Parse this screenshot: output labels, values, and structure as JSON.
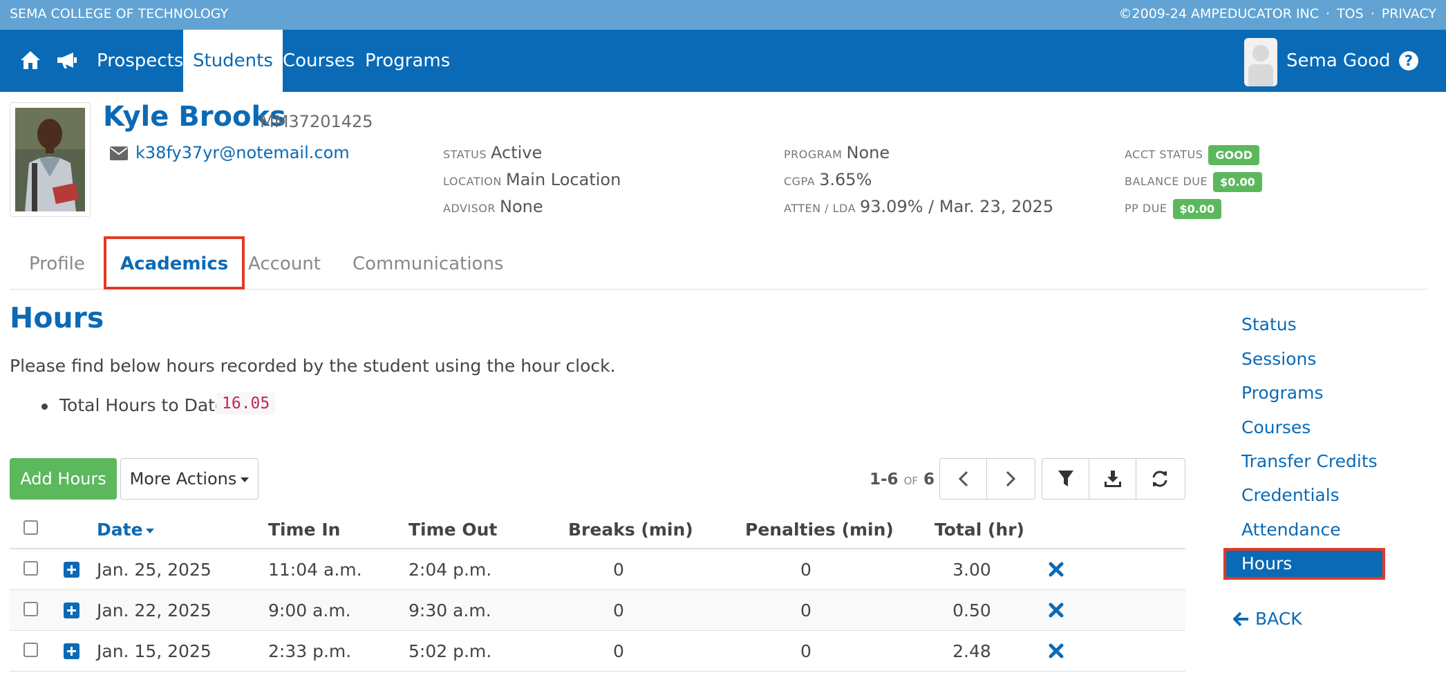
{
  "topbar": {
    "college": "SEMA COLLEGE OF TECHNOLOGY",
    "copyright": "©2009-24 AMPEDUCATOR INC",
    "sep": "·",
    "tos": "TOS",
    "privacy": "PRIVACY"
  },
  "nav": {
    "items": [
      "Prospects",
      "Students",
      "Courses",
      "Programs"
    ],
    "active": "Students",
    "user": "Sema Good"
  },
  "student": {
    "name": "Kyle Brooks",
    "id": "MM37201425",
    "email": "k38fy37yr@notemail.com",
    "status_label": "STATUS",
    "status": "Active",
    "location_label": "LOCATION",
    "location": "Main Location",
    "advisor_label": "ADVISOR",
    "advisor": "None",
    "program_label": "PROGRAM",
    "program": "None",
    "cgpa_label": "CGPA",
    "cgpa": "3.65%",
    "atten_label": "ATTEN / LDA",
    "atten": "93.09% / Mar. 23, 2025",
    "acct_status_label": "ACCT STATUS",
    "acct_status": "GOOD",
    "balance_label": "BALANCE DUE",
    "balance": "$0.00",
    "pp_due_label": "PP DUE",
    "pp_due": "$0.00"
  },
  "tabs": [
    "Profile",
    "Academics",
    "Account",
    "Communications"
  ],
  "active_tab": "Academics",
  "content": {
    "title": "Hours",
    "intro": "Please find below hours recorded by the student using the hour clock.",
    "total_label": "Total Hours to Date:",
    "total_value": "16.05",
    "add_button": "Add Hours",
    "more_button": "More Actions",
    "pager": {
      "range": "1-6",
      "of": "OF",
      "total": "6"
    }
  },
  "table": {
    "columns": [
      "Date",
      "Time In",
      "Time Out",
      "Breaks (min)",
      "Penalties (min)",
      "Total (hr)"
    ],
    "rows": [
      {
        "date": "Jan. 25, 2025",
        "time_in": "11:04 a.m.",
        "time_out": "2:04 p.m.",
        "breaks": "0",
        "penalties": "0",
        "total": "3.00"
      },
      {
        "date": "Jan. 22, 2025",
        "time_in": "9:00 a.m.",
        "time_out": "9:30 a.m.",
        "breaks": "0",
        "penalties": "0",
        "total": "0.50"
      },
      {
        "date": "Jan. 15, 2025",
        "time_in": "2:33 p.m.",
        "time_out": "5:02 p.m.",
        "breaks": "0",
        "penalties": "0",
        "total": "2.48"
      }
    ]
  },
  "sidebar": {
    "items": [
      "Status",
      "Sessions",
      "Programs",
      "Courses",
      "Transfer Credits",
      "Credentials",
      "Attendance",
      "Hours"
    ],
    "active": "Hours",
    "back": "BACK"
  },
  "colors": {
    "primary": "#0a6ab6",
    "topbar": "#62a3d3",
    "success": "#5cb85c",
    "highlight": "#e23a25"
  },
  "icons": [
    "home-icon",
    "megaphone-icon",
    "help-icon",
    "email-icon",
    "chevron-left-icon",
    "chevron-right-icon",
    "filter-icon",
    "download-icon",
    "refresh-icon",
    "expand-icon",
    "delete-icon",
    "arrow-left-icon"
  ]
}
